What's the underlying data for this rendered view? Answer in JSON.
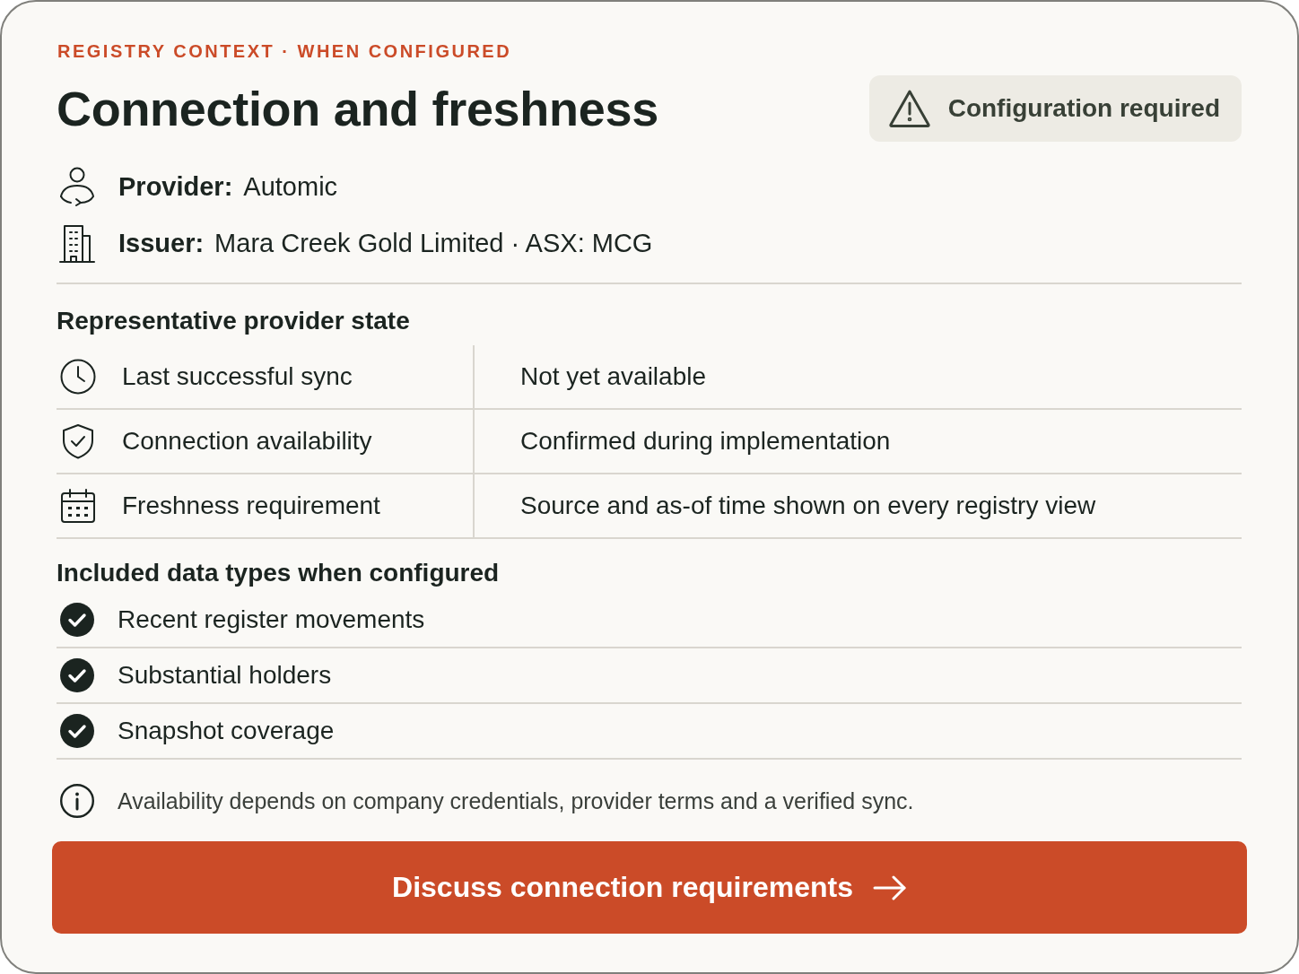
{
  "eyebrow": "REGISTRY CONTEXT · WHEN CONFIGURED",
  "title": "Connection and freshness",
  "status_badge": {
    "label": "Configuration required"
  },
  "details": [
    {
      "label": "Provider:",
      "value": "Automic"
    },
    {
      "label": "Issuer:",
      "value": "Mara Creek Gold Limited · ASX: MCG"
    }
  ],
  "provider_state": {
    "heading": "Representative provider state",
    "rows": [
      {
        "label": "Last successful sync",
        "value": "Not yet available"
      },
      {
        "label": "Connection availability",
        "value": "Confirmed during implementation"
      },
      {
        "label": "Freshness requirement",
        "value": "Source and as-of time shown on every registry view"
      }
    ]
  },
  "data_types": {
    "heading": "Included data types when configured",
    "items": [
      {
        "label": "Recent register movements",
        "checked": true
      },
      {
        "label": "Substantial holders",
        "checked": true
      },
      {
        "label": "Snapshot coverage",
        "checked": true
      }
    ]
  },
  "note": "Availability depends on company credentials, provider terms and a verified sync.",
  "action_button": {
    "label": "Discuss connection requirements"
  }
}
